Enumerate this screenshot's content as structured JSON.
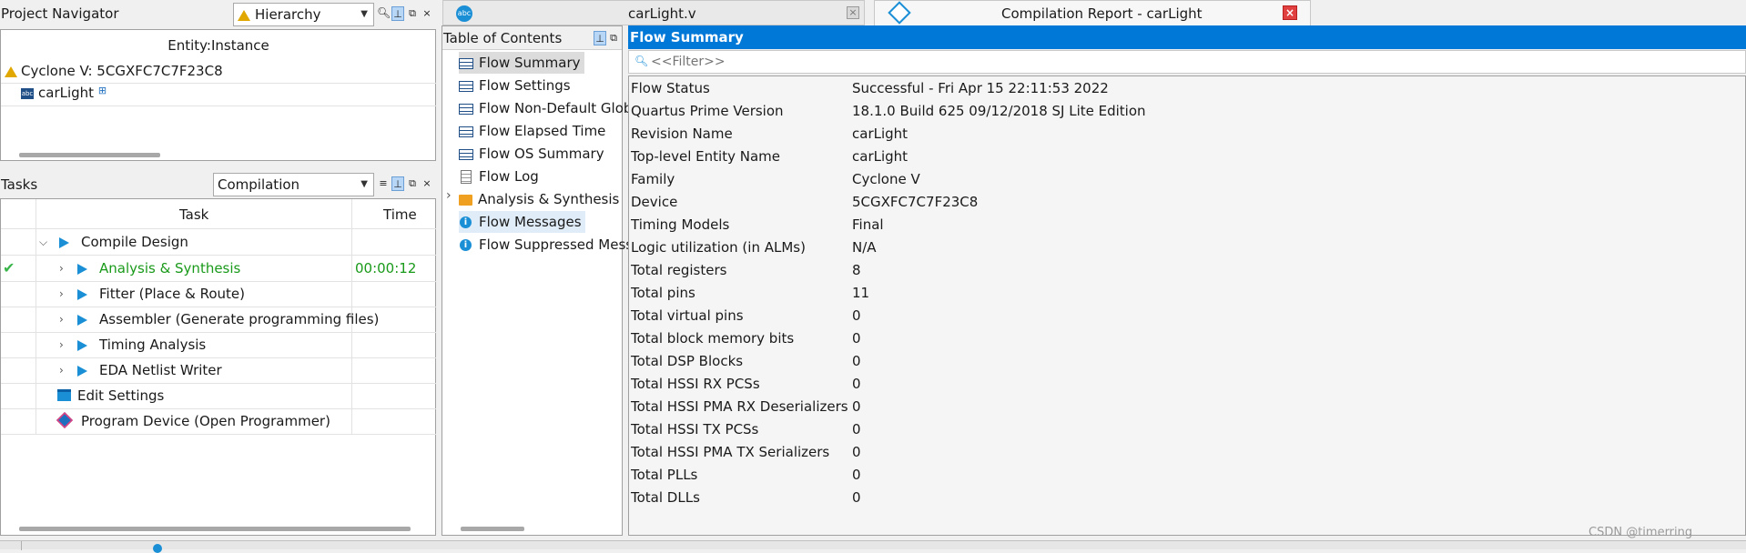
{
  "project_navigator": {
    "title": "Project Navigator",
    "view_select": "Hierarchy",
    "column_header": "Entity:Instance",
    "device": "Cyclone V: 5CGXFC7C7F23C8",
    "top_entity": "carLight"
  },
  "tasks": {
    "title": "Tasks",
    "flow_select": "Compilation",
    "col_task": "Task",
    "col_time": "Time",
    "rows": [
      {
        "label": "Compile Design",
        "time": ""
      },
      {
        "label": "Analysis & Synthesis",
        "time": "00:00:12"
      },
      {
        "label": "Fitter (Place & Route)",
        "time": ""
      },
      {
        "label": "Assembler (Generate programming files)",
        "time": ""
      },
      {
        "label": "Timing Analysis",
        "time": ""
      },
      {
        "label": "EDA Netlist Writer",
        "time": ""
      },
      {
        "label": "Edit Settings",
        "time": ""
      },
      {
        "label": "Program Device (Open Programmer)",
        "time": ""
      }
    ]
  },
  "tabs": {
    "file_tab": "carLight.v",
    "report_tab": "Compilation Report - carLight"
  },
  "toc": {
    "title": "Table of Contents",
    "items": [
      "Flow Summary",
      "Flow Settings",
      "Flow Non-Default Glob",
      "Flow Elapsed Time",
      "Flow OS Summary",
      "Flow Log",
      "Analysis & Synthesis",
      "Flow Messages",
      "Flow Suppressed Mess"
    ]
  },
  "summary": {
    "title": "Flow Summary",
    "filter_placeholder": "<<Filter>>",
    "rows": [
      {
        "key": "Flow Status",
        "value": "Successful - Fri Apr 15 22:11:53 2022"
      },
      {
        "key": "Quartus Prime Version",
        "value": "18.1.0 Build 625 09/12/2018 SJ Lite Edition"
      },
      {
        "key": "Revision Name",
        "value": "carLight"
      },
      {
        "key": "Top-level Entity Name",
        "value": "carLight"
      },
      {
        "key": "Family",
        "value": "Cyclone V"
      },
      {
        "key": "Device",
        "value": "5CGXFC7C7F23C8"
      },
      {
        "key": "Timing Models",
        "value": "Final"
      },
      {
        "key": "Logic utilization (in ALMs)",
        "value": "N/A"
      },
      {
        "key": "Total registers",
        "value": "8"
      },
      {
        "key": "Total pins",
        "value": "11"
      },
      {
        "key": "Total virtual pins",
        "value": "0"
      },
      {
        "key": "Total block memory bits",
        "value": "0"
      },
      {
        "key": "Total DSP Blocks",
        "value": "0"
      },
      {
        "key": "Total HSSI RX PCSs",
        "value": "0"
      },
      {
        "key": "Total HSSI PMA RX Deserializers",
        "value": "0"
      },
      {
        "key": "Total HSSI TX PCSs",
        "value": "0"
      },
      {
        "key": "Total HSSI PMA TX Serializers",
        "value": "0"
      },
      {
        "key": "Total PLLs",
        "value": "0"
      },
      {
        "key": "Total DLLs",
        "value": "0"
      }
    ]
  },
  "watermark": "CSDN @timerring",
  "colors": {
    "accent": "#0078d7",
    "success_green": "#1a9a1a",
    "play_blue": "#1a8fd6",
    "close_red": "#e04040"
  }
}
